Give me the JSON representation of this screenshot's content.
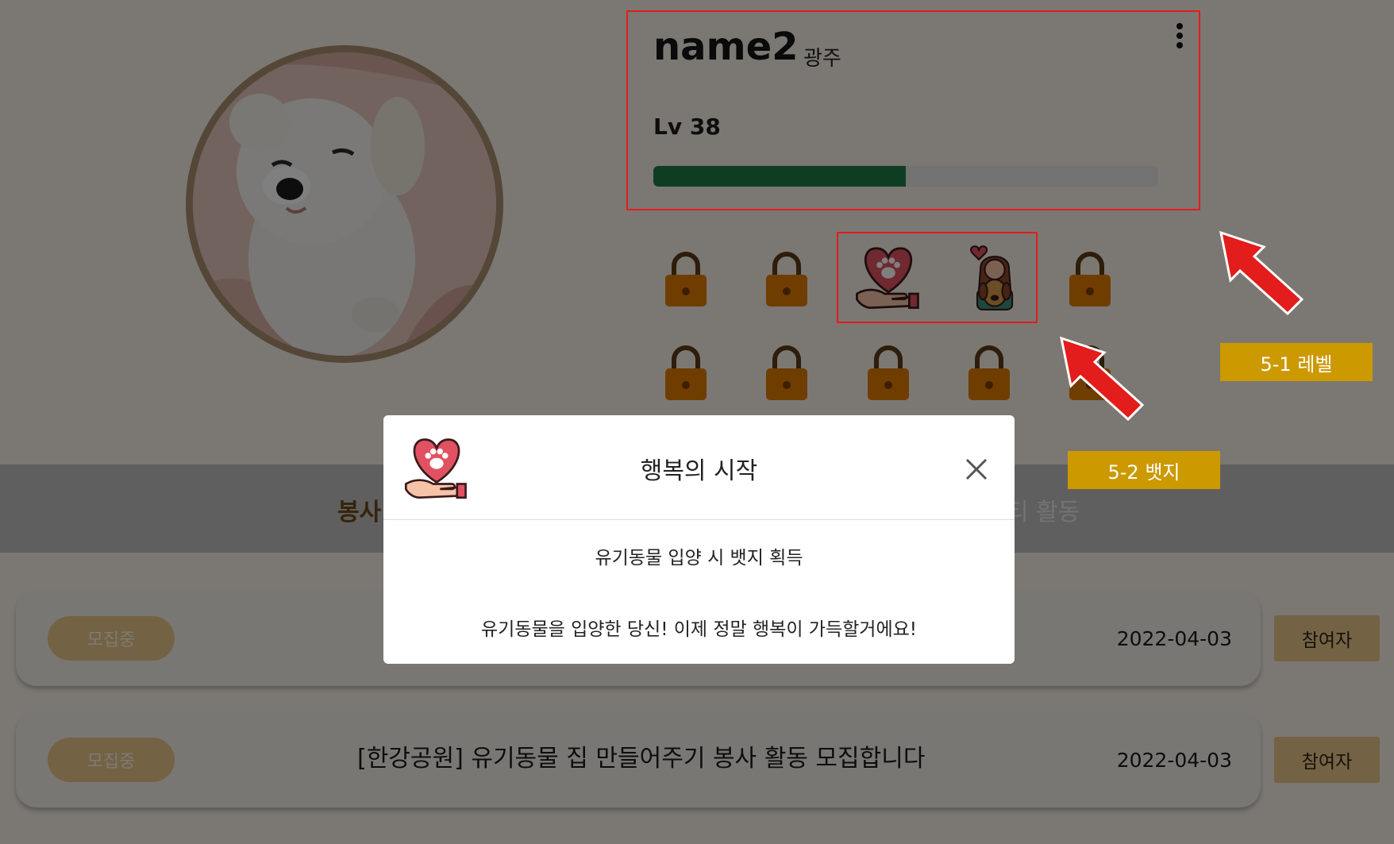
{
  "profile": {
    "username": "name2",
    "region": "광주",
    "level_label": "Lv 38",
    "level_progress": 0.5
  },
  "badges": {
    "row1": [
      "lock-icon",
      "lock-icon",
      "heart-hand-paw-badge-icon",
      "girl-with-dog-badge-icon",
      "lock-icon"
    ],
    "row2": [
      "lock-icon",
      "lock-icon",
      "lock-icon",
      "lock-icon",
      "lock-icon"
    ]
  },
  "tabs": {
    "left_label": "봉사",
    "right_label": "티 활동"
  },
  "posts": [
    {
      "status": "모집중",
      "title": "",
      "date": "2022-04-03",
      "join_label": "참여자"
    },
    {
      "status": "모집중",
      "title": "[한강공원] 유기동물 집 만들어주기 봉사 활동 모집합니다",
      "date": "2022-04-03",
      "join_label": "참여자"
    }
  ],
  "modal": {
    "title": "행복의 시작",
    "condition": "유기동물 입양 시 뱃지 획득",
    "description": "유기동물을 입양한 당신! 이제 정말 행복이 가득할거에요!"
  },
  "annotations": {
    "level_note": "5-1 레벨",
    "badge_note": "5-2 뱃지"
  },
  "colors": {
    "accent_brown": "#e6c488",
    "lock_orange": "#e07b00",
    "level_green": "#1f7a49",
    "highlight_red": "#e31c1c",
    "note_gold": "#cc9900"
  }
}
